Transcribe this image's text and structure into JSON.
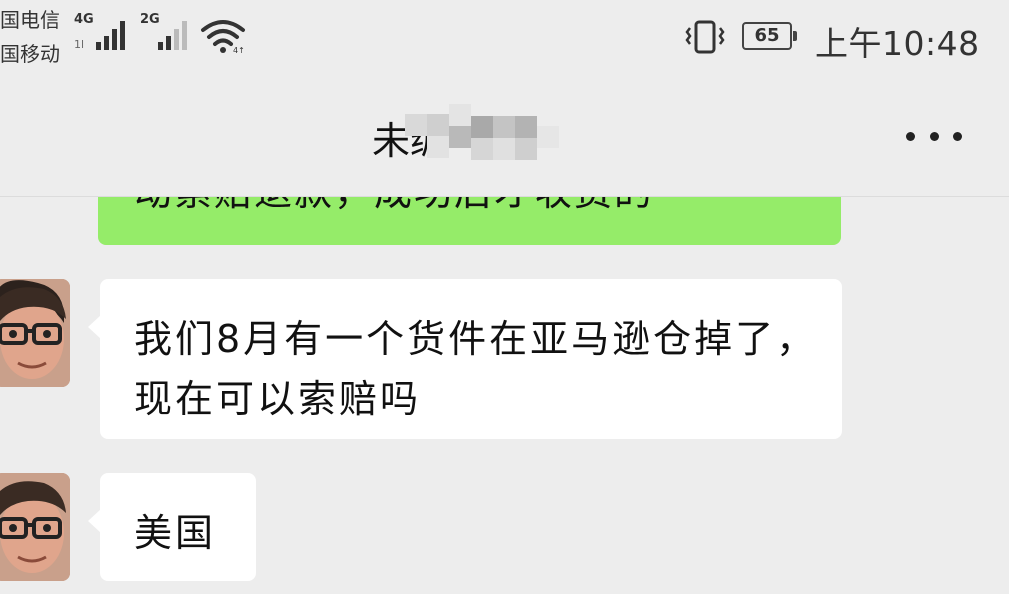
{
  "status_bar": {
    "carrier_1": "国电信",
    "carrier_2": "国移动",
    "network_1": "4G",
    "network_2": "2G",
    "battery_level": "65",
    "time": "上午10:48",
    "icons": [
      "signal-icon",
      "wifi-icon",
      "vibrate-icon",
      "battery-icon"
    ]
  },
  "header": {
    "title": "未编",
    "more_icon": "more-dots-icon"
  },
  "messages": [
    {
      "side": "right",
      "type": "text",
      "text": "动索赔退款，成功后才收费的"
    },
    {
      "side": "left",
      "type": "text",
      "text": "我们8月有一个货件在亚马逊仓掉了，现在可以索赔吗"
    },
    {
      "side": "left",
      "type": "text",
      "text": "美国"
    }
  ],
  "colors": {
    "background": "#ededed",
    "sent_bubble": "#95ec69",
    "received_bubble": "#ffffff",
    "text": "#111111"
  }
}
